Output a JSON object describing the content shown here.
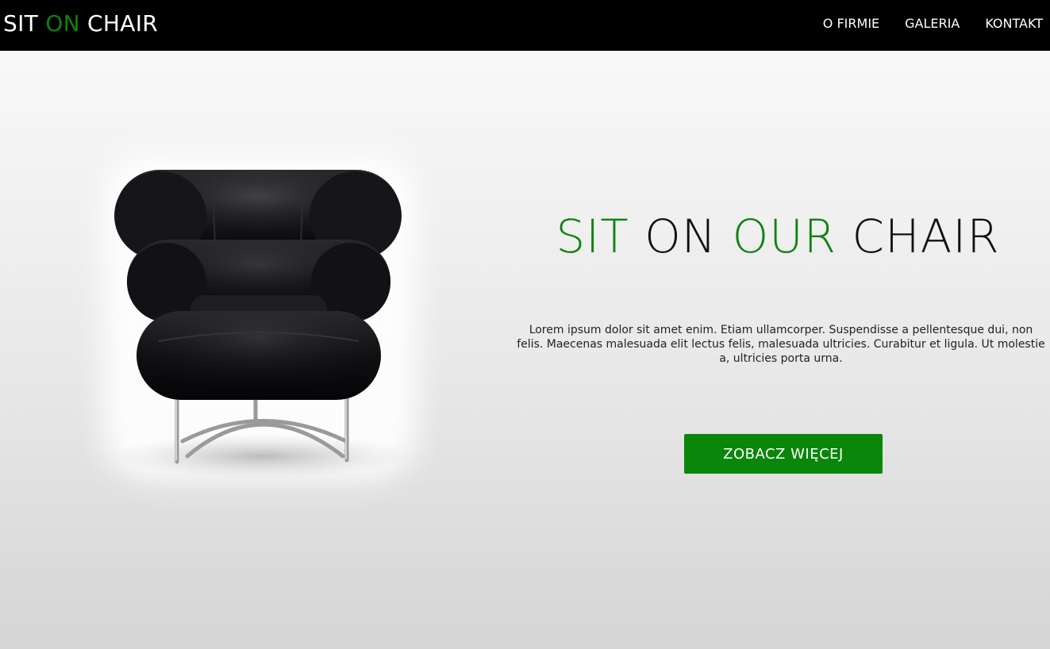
{
  "header": {
    "logo": {
      "part1": "SIT ",
      "part2": "ON",
      "part3": " CHAIR"
    },
    "nav": [
      {
        "label": "O FIRMIE"
      },
      {
        "label": "GALERIA"
      },
      {
        "label": "KONTAKT"
      }
    ]
  },
  "hero": {
    "headline": {
      "word1": "SIT",
      "word2": " ON ",
      "word3": "OUR",
      "word4": " CHAIR"
    },
    "body": "Lorem ipsum dolor sit amet enim. Etiam ullamcorper. Suspendisse a pellentesque dui, non felis. Maecenas malesuada elit lectus felis, malesuada ultricies. Curabitur et ligula. Ut molestie a, ultricies porta urna.",
    "cta_label": "ZOBACZ WIĘCEJ"
  },
  "colors": {
    "accent": "#128012",
    "button": "#0a860a",
    "navbar": "#000000"
  }
}
